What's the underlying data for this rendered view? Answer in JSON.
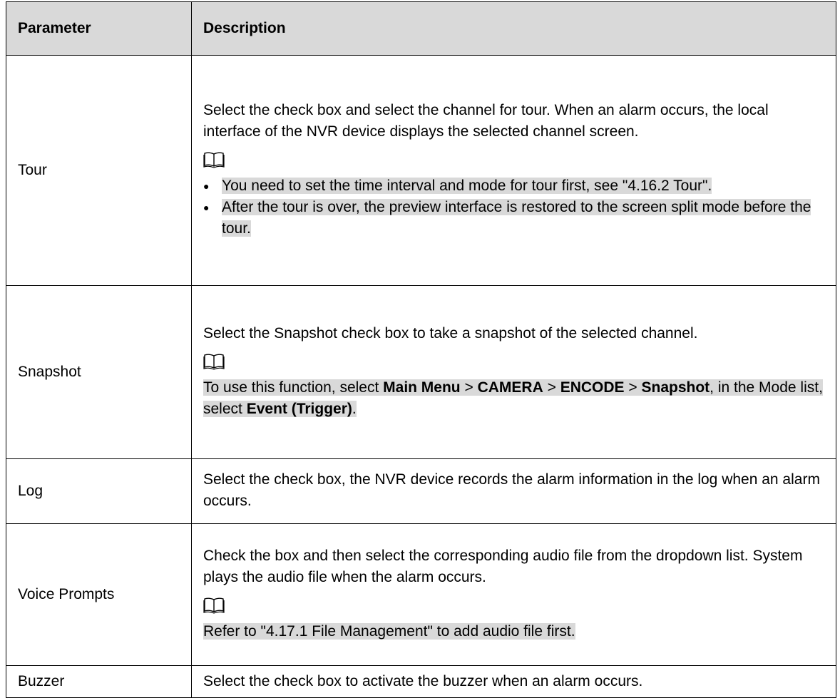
{
  "header": {
    "col1": "Parameter",
    "col2": "Description"
  },
  "rows": {
    "tour": {
      "name": "Tour",
      "desc": "Select the check box and select the channel for tour. When an alarm occurs, the local interface of the NVR device displays the selected channel screen.",
      "note_icon": "book-icon",
      "notes": [
        "You need to set the time interval and mode for tour first, see \"4.16.2 Tour\".",
        "After the tour is over, the preview interface is restored to the screen split mode before the tour."
      ]
    },
    "snapshot": {
      "name": "Snapshot",
      "desc": "Select the Snapshot check box to take a snapshot of the selected channel.",
      "note_icon": "book-icon",
      "note": {
        "t1": "To use this function, select ",
        "b1": "Main Menu",
        "t2": " > ",
        "b2": "CAMERA",
        "t3": " > ",
        "b3": "ENCODE",
        "t4": " > ",
        "b4": "Snapshot",
        "t5": ", in the Mode list, select ",
        "b5": "Event (Trigger)",
        "t6": "."
      }
    },
    "log": {
      "name": "Log",
      "desc": "Select the check box, the NVR device records the alarm information in the log when an alarm occurs."
    },
    "voice": {
      "name": "Voice Prompts",
      "desc": "Check the box and then select the corresponding audio file from the dropdown list. System plays the audio file when the alarm occurs.",
      "note_icon": "book-icon",
      "note": "Refer to \"4.17.1 File Management\" to add audio file first."
    },
    "buzzer": {
      "name": "Buzzer",
      "desc": "Select the check box to activate the buzzer when an alarm occurs."
    }
  },
  "colors": {
    "header_bg": "#d9d9d9",
    "highlight_bg": "#d9d9d9",
    "border": "#000000"
  }
}
